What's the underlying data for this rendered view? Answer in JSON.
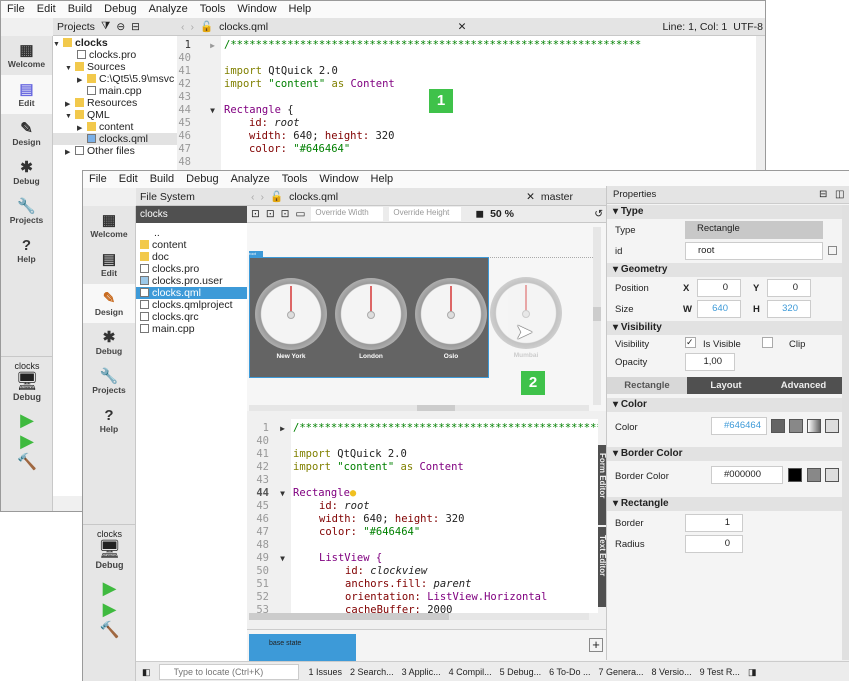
{
  "menu": [
    "File",
    "Edit",
    "Build",
    "Debug",
    "Analyze",
    "Tools",
    "Window",
    "Help"
  ],
  "modes": [
    {
      "label": "Welcome",
      "icon": "grid-icon"
    },
    {
      "label": "Edit",
      "icon": "edit-icon"
    },
    {
      "label": "Design",
      "icon": "pencil-icon"
    },
    {
      "label": "Debug",
      "icon": "bug-icon"
    },
    {
      "label": "Projects",
      "icon": "wrench-icon"
    },
    {
      "label": "Help",
      "icon": "help-icon"
    }
  ],
  "kit": {
    "project": "clocks",
    "config": "Debug"
  },
  "w1": {
    "active_mode": "Edit",
    "panel": "Projects",
    "file": "clocks.qml",
    "cursor": "Line: 1, Col: 1",
    "encoding": "UTF-8",
    "tree": [
      "clocks",
      "clocks.pro",
      "Sources",
      "C:\\Qt5\\5.9\\msvc",
      "main.cpp",
      "Resources",
      "QML",
      "content",
      "clocks.qml",
      "Other files"
    ],
    "gutter": [
      "1",
      "40",
      "41",
      "42",
      "43",
      "44",
      "45",
      "46",
      "47",
      "48"
    ],
    "badge": "1"
  },
  "w2": {
    "active_mode": "Design",
    "panel": "File System",
    "folder": "clocks",
    "file": "clocks.qml",
    "branch": "master",
    "override_width": "Override Width",
    "override_height": "Override Height",
    "zoom": "50 %",
    "files": [
      "..",
      "content",
      "doc",
      "clocks.pro",
      "clocks.pro.user",
      "clocks.qml",
      "clocks.qmlproject",
      "clocks.qrc",
      "main.cpp"
    ],
    "root_tag": "root",
    "clocks": [
      "New York",
      "London",
      "Oslo",
      "Mumbai"
    ],
    "badge": "2",
    "gutter": [
      "1",
      "40",
      "41",
      "42",
      "43",
      "44",
      "45",
      "46",
      "47",
      "48",
      "49",
      "50",
      "51",
      "52",
      "53"
    ],
    "side_tabs": [
      "Form Editor",
      "Text Editor"
    ],
    "state": "base state",
    "locate_placeholder": "Type to locate (Ctrl+K)",
    "outputs": [
      "1 Issues",
      "2 Search...",
      "3 Applic...",
      "4 Compil...",
      "5 Debug...",
      "6 To-Do ...",
      "7 Genera...",
      "8 Versio...",
      "9 Test R..."
    ]
  },
  "code": {
    "comment": "/*****************************************************************",
    "import1": [
      "import",
      "QtQuick",
      "2.0"
    ],
    "import2": [
      "import",
      "\"content\"",
      "as",
      "Content"
    ],
    "rect": "Rectangle",
    "id": [
      "id:",
      "root"
    ],
    "size": [
      "width:",
      "640;",
      "height:",
      "320"
    ],
    "color": [
      "color:",
      "\"#646464\""
    ],
    "listview": "ListView {",
    "lv_id": [
      "id:",
      "clockview"
    ],
    "anchors": [
      "anchors.fill:",
      "parent"
    ],
    "orient": [
      "orientation:",
      "ListView.Horizontal"
    ],
    "cache": [
      "cacheBuffer:",
      "2000"
    ]
  },
  "properties": {
    "title": "Properties",
    "sections": [
      "Type",
      "Geometry",
      "Visibility",
      "Color",
      "Border Color",
      "Rectangle"
    ],
    "type_label": "Type",
    "type_value": "Rectangle",
    "id_label": "id",
    "id_value": "root",
    "position_label": "Position",
    "x_label": "X",
    "x": "0",
    "y_label": "Y",
    "y": "0",
    "size_label": "Size",
    "w_label": "W",
    "w": "640",
    "h_label": "H",
    "h": "320",
    "visibility_label": "Visibility",
    "is_visible": "Is Visible",
    "clip": "Clip",
    "visible_checked": true,
    "clip_checked": false,
    "opacity_label": "Opacity",
    "opacity": "1,00",
    "tabs": [
      "Rectangle",
      "Layout",
      "Advanced"
    ],
    "color_label": "Color",
    "color": "#646464",
    "border_color_label": "Border Color",
    "border_color": "#000000",
    "border_label": "Border",
    "border": "1",
    "radius_label": "Radius",
    "radius": "0"
  },
  "colors": {
    "accent": "#3d9ad8",
    "badge": "#3fc24a",
    "canvas_root": "#646464"
  }
}
